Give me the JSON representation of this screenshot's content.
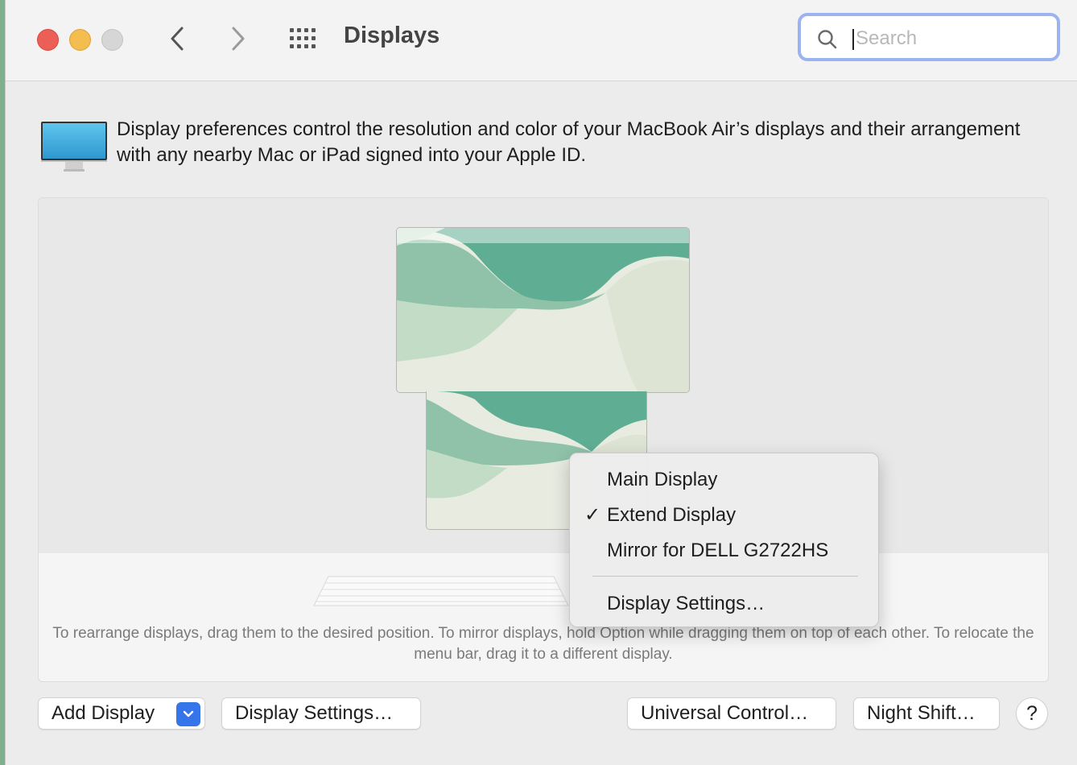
{
  "window": {
    "title": "Displays",
    "search": {
      "placeholder": "Search",
      "value": ""
    }
  },
  "info": {
    "text": "Display preferences control the resolution and color of your MacBook Air’s displays and their arrangement with any nearby Mac or iPad signed into your Apple ID."
  },
  "arrangement": {
    "hint": "To rearrange displays, drag them to the desired position. To mirror displays, hold Option while dragging them on top of each other. To relocate the menu bar, drag it to a different display."
  },
  "context_menu": {
    "items": [
      {
        "label": "Main Display",
        "checked": false
      },
      {
        "label": "Extend Display",
        "checked": true
      },
      {
        "label": "Mirror for DELL G2722HS",
        "checked": false
      }
    ],
    "settings_label": "Display Settings…",
    "check_glyph": "✓"
  },
  "buttons": {
    "add_display": "Add Display",
    "display_settings": "Display Settings…",
    "universal_control": "Universal Control…",
    "night_shift": "Night Shift…",
    "help": "?"
  },
  "colors": {
    "accent": "#3574e9",
    "search_focus_ring": "#9bb4ef",
    "close": "#ec5f57",
    "minimize": "#f4bd4f",
    "wallpaper_dark": "#5fae93",
    "wallpaper_mid": "#8fc2a8",
    "wallpaper_light": "#e7ebe0"
  },
  "icons": {
    "back": "chevron-left-icon",
    "forward": "chevron-right-icon",
    "grid": "grid-icon",
    "search": "magnifying-glass-icon",
    "displays": "display-icon",
    "dropdown": "chevron-down-icon"
  }
}
